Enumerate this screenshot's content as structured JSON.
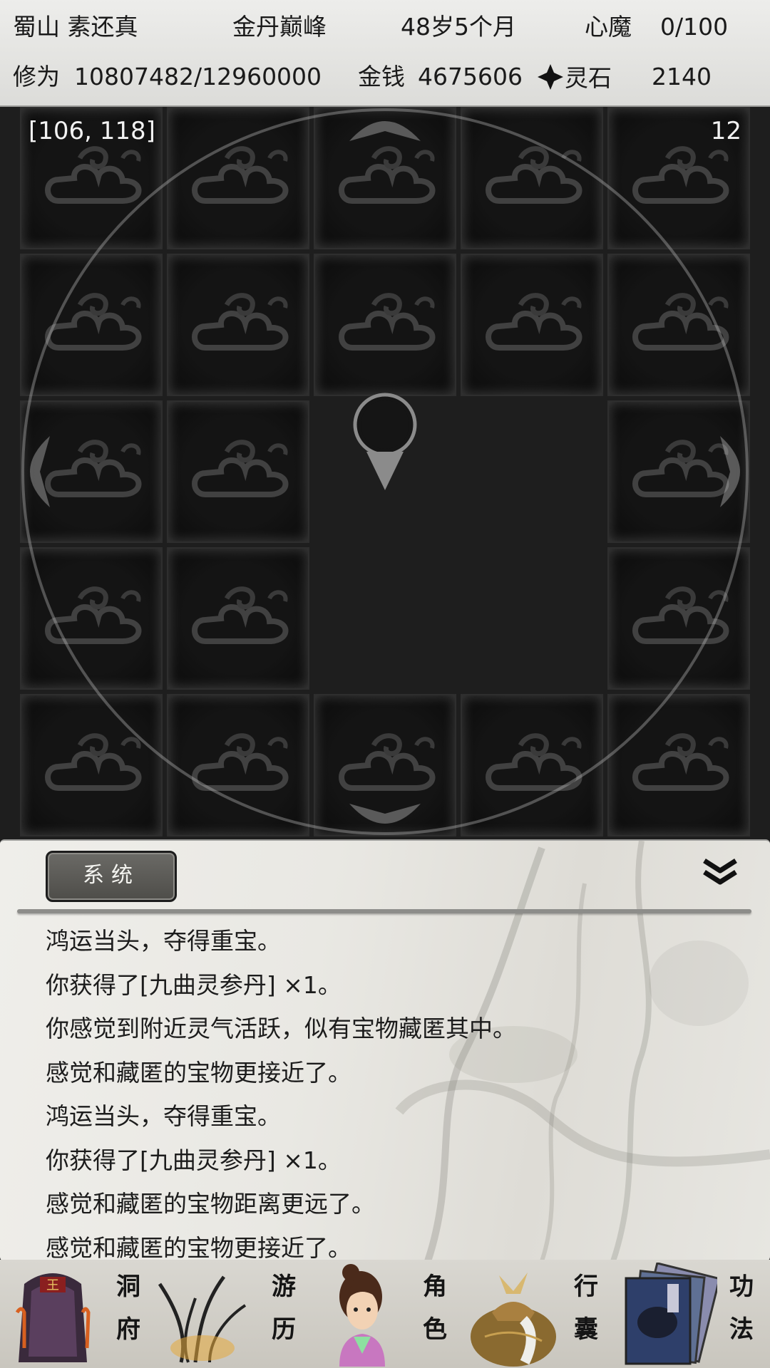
{
  "header": {
    "sect_name": "蜀山 素还真",
    "realm": "金丹巅峰",
    "age": "48岁5个月",
    "heart_demon_label": "心魔",
    "heart_demon_value": "0/100",
    "cultivation_label": "修为",
    "cultivation_value": "10807482/12960000",
    "money_label": "金钱",
    "money_value": "4675606",
    "spirit_stone_label": "灵石",
    "spirit_stone_value": "2140"
  },
  "map": {
    "coordinates": "[106, 118]",
    "counter": "12"
  },
  "log": {
    "tab_label": "系统",
    "messages": [
      "鸿运当头，夺得重宝。",
      "你获得了[九曲灵参丹] ×1。",
      "你感觉到附近灵气活跃，似有宝物藏匿其中。",
      "感觉和藏匿的宝物更接近了。",
      "鸿运当头，夺得重宝。",
      "你获得了[九曲灵参丹] ×1。",
      "感觉和藏匿的宝物距离更远了。",
      "感觉和藏匿的宝物更接近了。"
    ]
  },
  "nav": {
    "items": [
      {
        "label_top": "洞",
        "label_bottom": "府"
      },
      {
        "label_top": "游",
        "label_bottom": "历"
      },
      {
        "label_top": "角",
        "label_bottom": "色"
      },
      {
        "label_top": "行",
        "label_bottom": "囊"
      },
      {
        "label_top": "功",
        "label_bottom": "法"
      }
    ]
  }
}
